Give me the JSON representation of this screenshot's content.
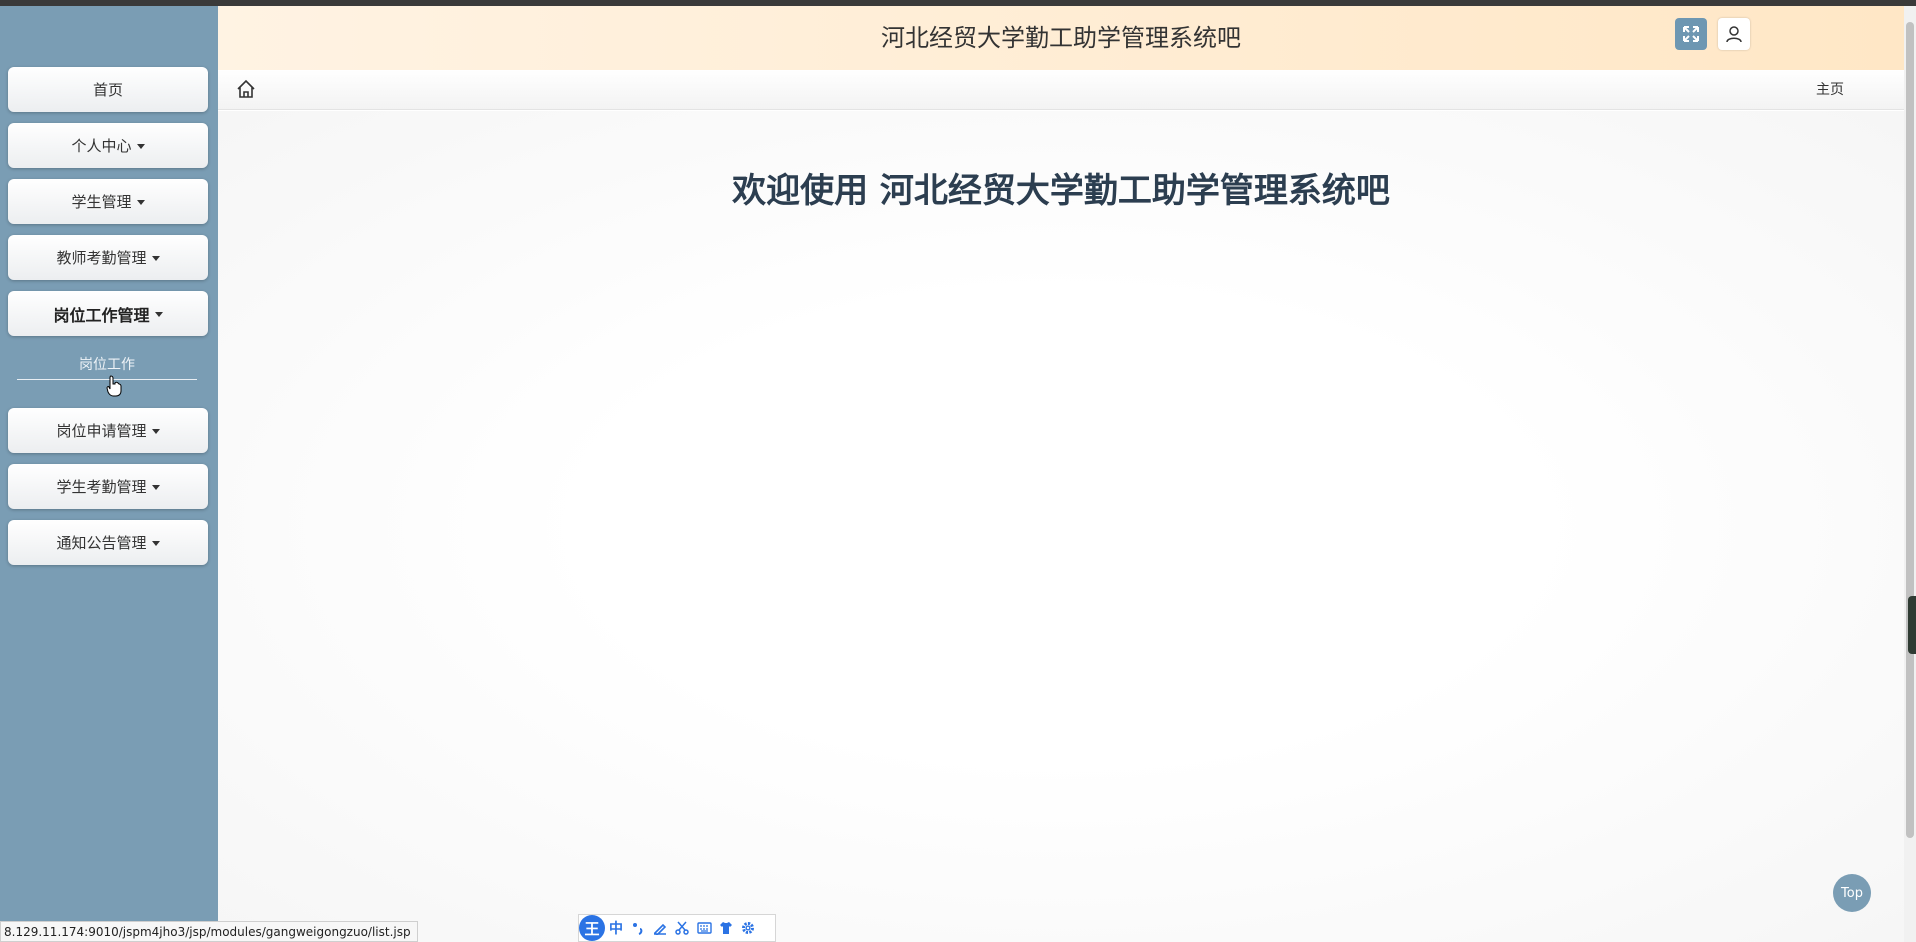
{
  "header": {
    "title": "河北经贸大学勤工助学管理系统吧",
    "fullscreen_icon": "expand-icon",
    "user_icon": "user-icon"
  },
  "sidebar": {
    "items": [
      {
        "label": "首页",
        "has_caret": false
      },
      {
        "label": "个人中心",
        "has_caret": true
      },
      {
        "label": "学生管理",
        "has_caret": true
      },
      {
        "label": "教师考勤管理",
        "has_caret": true
      },
      {
        "label": "岗位工作管理",
        "has_caret": true,
        "expanded": true
      },
      {
        "label": "岗位申请管理",
        "has_caret": true
      },
      {
        "label": "学生考勤管理",
        "has_caret": true
      },
      {
        "label": "通知公告管理",
        "has_caret": true
      }
    ],
    "subitems": [
      {
        "label": "岗位工作"
      }
    ]
  },
  "breadcrumb": {
    "home_icon": "home-icon",
    "right_label": "主页"
  },
  "main": {
    "welcome_text": "欢迎使用 河北经贸大学勤工助学管理系统吧"
  },
  "top_button": {
    "label": "Top"
  },
  "status_bar": {
    "url": "8.129.11.174:9010/jspm4jho3/jsp/modules/gangweigongzuo/list.jsp"
  },
  "ime_toolbar": {
    "logo": "王",
    "mode": "中",
    "icons": [
      "punctuation-icon",
      "pen-icon",
      "scissors-icon",
      "keyboard-icon",
      "shirt-icon",
      "gear-icon"
    ]
  },
  "colors": {
    "sidebar_bg": "#7a9db4",
    "header_gradient_start": "#fff3e3",
    "header_gradient_end": "#ffe7c6",
    "welcome_text": "#2c3e50",
    "ime_blue": "#2b73e4"
  }
}
